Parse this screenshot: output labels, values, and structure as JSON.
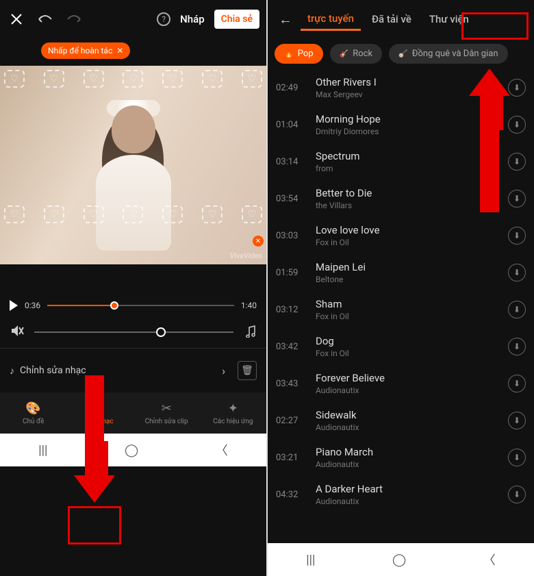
{
  "left": {
    "header": {
      "undo_tooltip": "Hoàn tác",
      "redo_tooltip": "Làm lại",
      "help": "?",
      "draft_label": "Nháp",
      "share_label": "Chia sẻ"
    },
    "undo_pill": "Nhấp để hoàn tác",
    "watermark": "VivaVideo",
    "playback": {
      "current": "0:36",
      "total": "1:40"
    },
    "edit_music_label": "Chỉnh sửa nhạc",
    "nav": {
      "theme": "Chủ đề",
      "music": "Âm nhạc",
      "clip": "Chỉnh sửa clip",
      "effect": "Các hiệu ứng"
    }
  },
  "right": {
    "tabs": {
      "online": "trực tuyến",
      "downloaded": "Đã tải về",
      "library": "Thư viện"
    },
    "genres": {
      "pop": "Pop",
      "rock": "Rock",
      "country": "Đồng quê và Dân gian"
    },
    "songs": [
      {
        "dur": "02:49",
        "title": "Other Rivers I",
        "artist": "Max Sergeev"
      },
      {
        "dur": "01:04",
        "title": "Morning Hope",
        "artist": "Dmitriy Diomores"
      },
      {
        "dur": "03:14",
        "title": "Spectrum",
        "artist": "from"
      },
      {
        "dur": "03:54",
        "title": "Better to Die",
        "artist": "the Villars"
      },
      {
        "dur": "03:03",
        "title": "Love love love",
        "artist": "Fox in Oil"
      },
      {
        "dur": "01:59",
        "title": "Maipen Lei",
        "artist": "Beltone"
      },
      {
        "dur": "03:12",
        "title": "Sham",
        "artist": "Fox in Oil"
      },
      {
        "dur": "03:42",
        "title": "Dog",
        "artist": "Fox in Oil"
      },
      {
        "dur": "03:43",
        "title": "Forever Believe",
        "artist": "Audionautix"
      },
      {
        "dur": "02:27",
        "title": "Sidewalk",
        "artist": "Audionautix"
      },
      {
        "dur": "03:21",
        "title": "Piano March",
        "artist": "Audionautix"
      },
      {
        "dur": "04:32",
        "title": "A Darker Heart",
        "artist": "Audionautix"
      }
    ]
  },
  "sysnav": {
    "recent": "|||",
    "home": "◯",
    "back": "〈"
  }
}
